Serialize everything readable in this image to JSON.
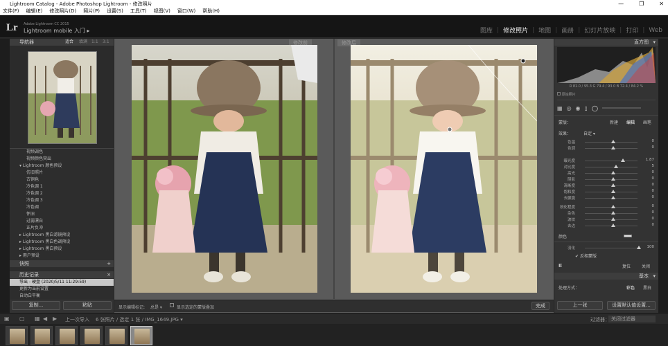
{
  "window": {
    "title": "Lightroom Catalog - Adobe Photoshop Lightroom - 修改照片",
    "controls": [
      "—",
      "❐",
      "✕"
    ]
  },
  "menu": [
    "文件(F)",
    "编辑(E)",
    "修改照片(D)",
    "照片(P)",
    "设置(S)",
    "工具(T)",
    "视图(V)",
    "窗口(W)",
    "帮助(H)"
  ],
  "identity": {
    "logo": "Lr",
    "small": "Adobe Lightroom CC 2015",
    "mobile": "Lightroom mobile 入门 ▸"
  },
  "modules": [
    "图库",
    "修改照片",
    "地图",
    "画册",
    "幻灯片放映",
    "打印",
    "Web"
  ],
  "active_module": "修改照片",
  "left": {
    "navigator_title": "导航器",
    "navigator_zoom": [
      "适合",
      "填满",
      "1:1",
      "3:1"
    ],
    "presets": [
      "视频调色",
      "视频颜色突出",
      "Lightroom 颜色预设",
      "仿旧照片",
      "古铜色",
      "冷色调 1",
      "冷色调 2",
      "冷色调 3",
      "冷色调",
      "怀旧",
      "过弱漂白",
      "正片负冲",
      "Lightroom 黑白滤镜预设",
      "Lightroom 黑白色调预设",
      "Lightroom 黑白预设",
      "用户预设"
    ],
    "snapshots_title": "快照",
    "history_title": "历史记录",
    "history": [
      "导出 - 硬盘 (2020/5/11 11:29:59)",
      "更新为当前设置",
      "自动白平衡"
    ],
    "copy_label": "复制...",
    "paste_label": "粘贴"
  },
  "center": {
    "before_label": "修改前",
    "after_label": "修改后",
    "toolbar_text": "显示编辑标记:",
    "toolbar_value": "总是 ▾",
    "toolbar_check": "显示选定的蒙版叠加",
    "done_label": "完成"
  },
  "right": {
    "histogram_title": "直方图",
    "readout": "R 81.0 / 95.3  G 79.4 / 93.0  B 72.4 / 84.2 %",
    "original_label": "原始照片",
    "mask_label": "蒙版：",
    "mask_tabs": [
      "新建",
      "编辑",
      "画笔"
    ],
    "effect_label": "效果：",
    "effect_value": "自定 ▾",
    "sliders": [
      {
        "name": "色温",
        "value": "0"
      },
      {
        "name": "色调",
        "value": "0"
      },
      {
        "name": "曝光度",
        "value": "1.87"
      },
      {
        "name": "对比度",
        "value": "5"
      },
      {
        "name": "高光",
        "value": "0"
      },
      {
        "name": "阴影",
        "value": "0"
      },
      {
        "name": "清晰度",
        "value": "0"
      },
      {
        "name": "饱和度",
        "value": "0"
      },
      {
        "name": "去朦胧",
        "value": "0"
      },
      {
        "name": "锐化程度",
        "value": "0"
      },
      {
        "name": "杂色",
        "value": "0"
      },
      {
        "name": "波纹",
        "value": "0"
      },
      {
        "name": "去边",
        "value": "0"
      }
    ],
    "color_label": "颜色",
    "feather_label": "羽化",
    "feather_value": "100",
    "auto_mask": "反相蒙版",
    "reset_label": "复位",
    "close_label": "关闭",
    "basic_title": "基本",
    "treatment_label": "处理方式：",
    "treatment_color": "彩色",
    "treatment_bw": "黑白",
    "prev_label": "上一张",
    "reset_all_label": "设置默认值设置..."
  },
  "filmstrip_bar": {
    "source": "上一次导入",
    "count": "6 张照片 / 选定 1 张 / IMG_1649.JPG ▾",
    "filter_label": "过滤器：",
    "filter_value": "关闭过滤器"
  },
  "thumb_count": 6
}
